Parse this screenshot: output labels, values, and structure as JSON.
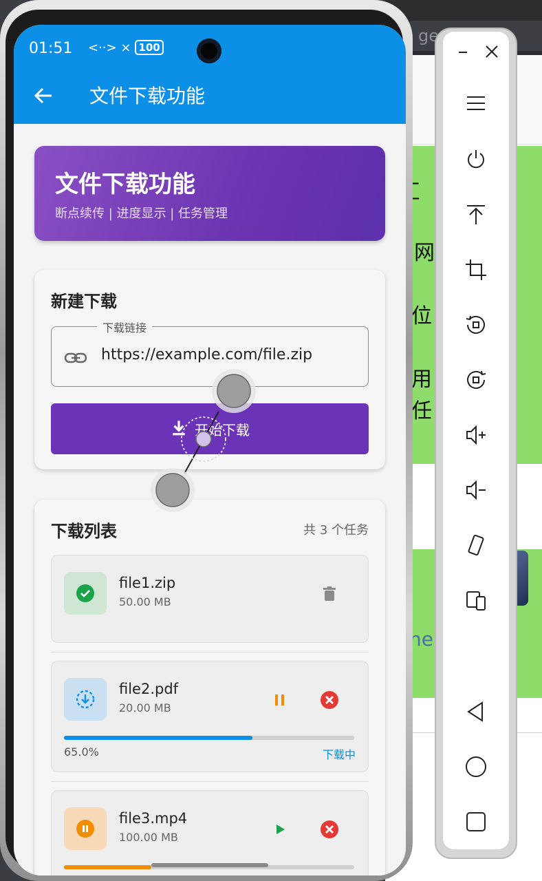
{
  "background": {
    "url_fragment": "ge.de",
    "chars": [
      "匚",
      "网",
      "位",
      "用",
      "任"
    ],
    "link_fragment": "ne"
  },
  "status_bar": {
    "time": "01:51",
    "signal": "<··> ×",
    "battery": "100"
  },
  "app_bar": {
    "title": "文件下载功能"
  },
  "hero": {
    "title": "文件下载功能",
    "subtitle": "断点续传 | 进度显示 | 任务管理"
  },
  "new_download": {
    "title": "新建下载",
    "url_label": "下载链接",
    "url_value": "https://example.com/file.zip",
    "start_label": "开始下载"
  },
  "download_list": {
    "title": "下载列表",
    "count_text": "共 3 个任务",
    "tasks": [
      {
        "name": "file1.zip",
        "size": "50.00 MB",
        "status": "completed",
        "progress": 1.0
      },
      {
        "name": "file2.pdf",
        "size": "20.00 MB",
        "status": "downloading",
        "progress": 0.65,
        "progress_text": "65.0%",
        "status_text": "下载中"
      },
      {
        "name": "file3.mp4",
        "size": "100.00 MB",
        "status": "paused",
        "progress": 0.3
      }
    ]
  },
  "colors": {
    "app_bar": "#0c8fe6",
    "primary_purple": "#6a33b8",
    "success": "#1aa34a",
    "warning": "#f28c00",
    "danger": "#e53935"
  },
  "toolbar_icons": [
    "minimize-icon",
    "close-icon",
    "menu-icon",
    "power-icon",
    "top-icon",
    "crop-icon",
    "rotate-left-icon",
    "rotate-right-icon",
    "volume-up-icon",
    "volume-down-icon",
    "shake-icon",
    "multi-device-icon",
    "back-icon",
    "home-icon",
    "recent-icon"
  ]
}
